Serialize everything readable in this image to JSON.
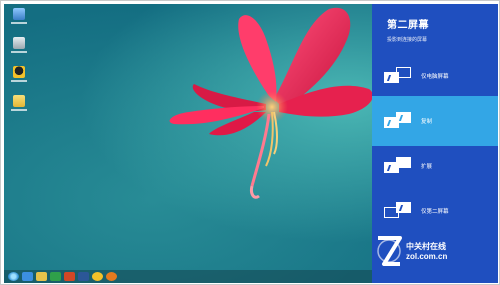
{
  "desktop": {
    "icons": [
      {
        "name": "computer-icon"
      },
      {
        "name": "recycle-bin-icon"
      },
      {
        "name": "qq-icon"
      },
      {
        "name": "app-icon"
      }
    ]
  },
  "taskbar": {
    "items": [
      "start",
      "ie",
      "folder",
      "store",
      "powerpoint",
      "word",
      "qq",
      "firefox"
    ],
    "clock": "",
    "colors": {
      "bar": "#2d6f78"
    }
  },
  "panel": {
    "title": "第二屏幕",
    "subtitle": "投影到连接的屏幕",
    "options": [
      {
        "label": "仅电脑屏幕",
        "mode": "pc-only",
        "selected": false
      },
      {
        "label": "复制",
        "mode": "duplicate",
        "selected": true
      },
      {
        "label": "扩展",
        "mode": "extend",
        "selected": false
      },
      {
        "label": "仅第二屏幕",
        "mode": "second-only",
        "selected": false
      }
    ],
    "colors": {
      "background": "#1f4fbf",
      "selected": "#33a6e6"
    }
  },
  "watermark": {
    "brand_cn": "中关村在线",
    "url": "zol.com.cn"
  }
}
